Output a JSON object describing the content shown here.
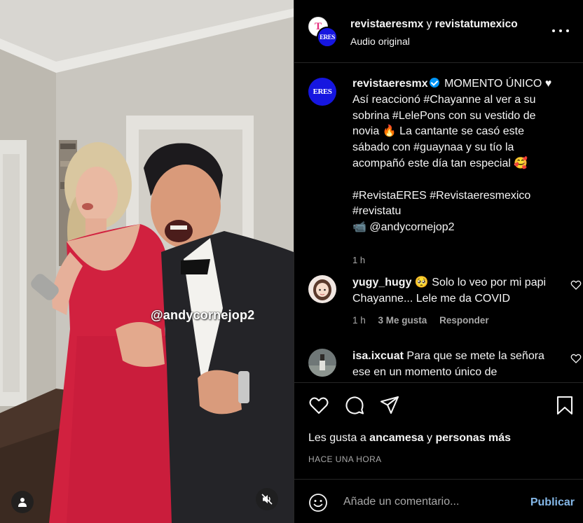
{
  "media": {
    "watermark": "@andycornejop2",
    "user_tag_icon": "user-icon",
    "mute_icon": "speaker-muted-icon"
  },
  "header": {
    "user1": "revistaeresmx",
    "connector": " y ",
    "user2": "revistatumexico",
    "subtitle": "Audio original",
    "avatar1_letter": "T",
    "avatar2_text": "ERES"
  },
  "caption": {
    "avatar_text": "ERES",
    "username": "revistaeresmx",
    "lines": [
      "MOMENTO ÚNICO ♥",
      "Así reaccionó #Chayanne al ver a su",
      "sobrina #LelePons con su vestido de",
      "novia 🔥 La cantante se casó este",
      "sábado con #guaynaa y su tío la",
      "acompañó este día tan especial 🥰",
      "",
      "#RevistaERES #Revistaeresmexico",
      "#revistatu",
      "📹 @andycornejop2"
    ],
    "time": "1 h"
  },
  "comments": [
    {
      "username": "yugy_hugy",
      "text": "🥺 Solo lo veo por mi papi Chayanne... Lele me da COVID",
      "time": "1 h",
      "likes": "3 Me gusta",
      "reply": "Responder"
    },
    {
      "username": "isa.ixcuat",
      "text": "Para que se mete la señora ese en un momento único de"
    }
  ],
  "actions": {
    "icons": [
      "heart-icon",
      "comment-icon",
      "share-icon",
      "bookmark-icon"
    ],
    "likes_prefix": "Les gusta a ",
    "likes_user": "ancamesa",
    "likes_connector": " y ",
    "likes_others": "personas más",
    "posted": "HACE UNA HORA"
  },
  "add_comment": {
    "placeholder": "Añade un comentario...",
    "publish": "Publicar"
  },
  "colors": {
    "background": "#000000",
    "text": "#f5f5f5",
    "muted": "#a8a8a8",
    "publish": "#85b8e8",
    "verified": "#0095f6",
    "eres_blue": "#1616e0"
  }
}
